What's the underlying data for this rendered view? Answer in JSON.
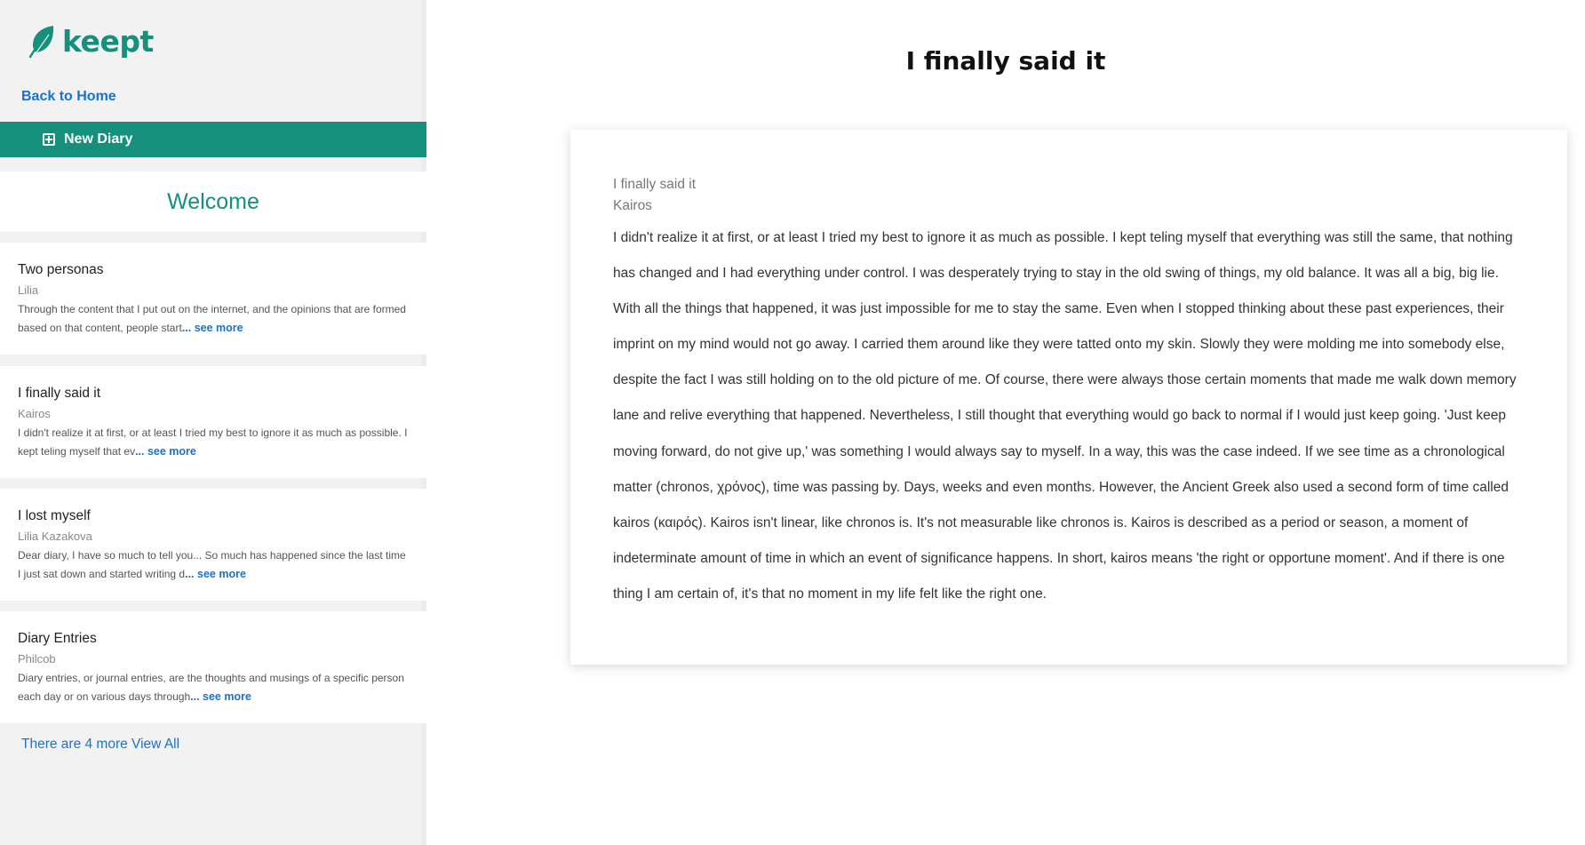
{
  "app": {
    "logo_text": "keept",
    "brand_color": "#14907d",
    "link_color": "#1a73c9"
  },
  "sidebar": {
    "back_label": "Back to Home",
    "new_diary_label": "New Diary",
    "welcome": "Welcome",
    "entries": [
      {
        "title": "Two personas",
        "author": "Lilia",
        "excerpt": "Through the content that I put out on the internet, and the opinions that are formed based on that content, people start",
        "see_more": "... see more"
      },
      {
        "title": "I finally said it",
        "author": "Kairos",
        "excerpt": "I didn't realize it at first, or at least I tried my best to ignore it as much as possible. I kept teling myself that ev",
        "see_more": "... see more"
      },
      {
        "title": "I lost myself",
        "author": "Lilia Kazakova",
        "excerpt": "Dear diary, I have so much to tell you... So much has happened since the last time I just sat down and started writing d",
        "see_more": "... see more"
      },
      {
        "title": "Diary Entries",
        "author": "Philcob",
        "excerpt": "Diary entries, or journal entries, are the thoughts and musings of a specific person each day or on various days through",
        "see_more": "... see more"
      }
    ],
    "more_link": "There are 4 more View All"
  },
  "main": {
    "page_title": "I finally said it",
    "card_title": "I finally said it",
    "card_author": "Kairos",
    "body": "I didn't realize it at first, or at least I tried my best to ignore it as much as possible. I kept teling myself that everything was still the same, that nothing has changed and I had everything under control. I was desperately trying to stay in the old swing of things, my old balance. It was all a big, big lie. With all the things that happened, it was just impossible for me to stay the same. Even when I stopped thinking about these past experiences, their imprint on my mind would not go away. I carried them around like they were tatted onto my skin. Slowly they were molding me into somebody else, despite the fact I was still holding on to the old picture of me. Of course, there were always those certain moments that made me walk down memory lane and relive everything that happened. Nevertheless, I still thought that everything would go back to normal if I would just keep going. 'Just keep moving forward, do not give up,' was something I would always say to myself. In a way, this was the case indeed. If we see time as a chronological matter (chronos, χρόνος), time was passing by. Days, weeks and even months. However, the Ancient Greek also used a second form of time called kairos (καιρός). Kairos isn't linear, like chronos is. It's not measurable like chronos is. Kairos is described as a period or season, a moment of indeterminate amount of time in which an event of significance happens. In short, kairos means 'the right or opportune moment'. And if there is one thing I am certain of, it's that no moment in my life felt like the right one."
  }
}
